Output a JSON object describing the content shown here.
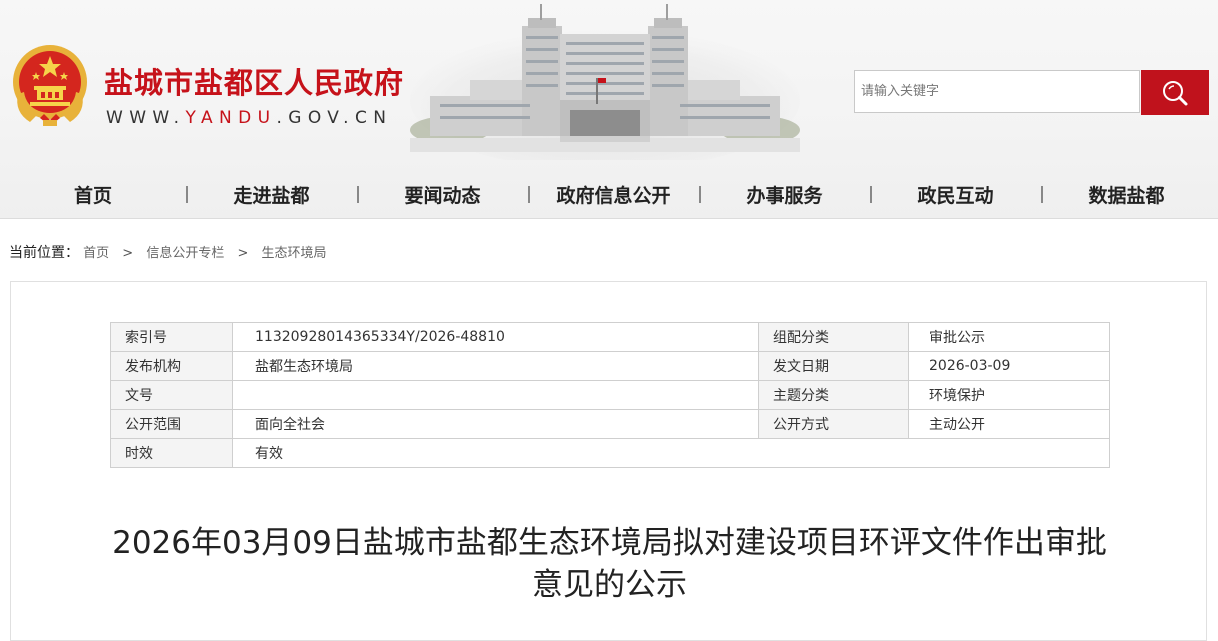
{
  "header": {
    "site_title": "盐城市盐都区人民政府",
    "domain": {
      "prefix": "WWW.",
      "accent": "YANDU",
      "suffix": ".GOV.CN"
    },
    "emblem_icon": "national-emblem-icon",
    "accent_color": "#c6121a"
  },
  "search": {
    "placeholder": "请输入关键字",
    "button_icon": "search-icon"
  },
  "nav": {
    "items": [
      "首页",
      "走进盐都",
      "要闻动态",
      "政府信息公开",
      "办事服务",
      "政民互动",
      "数据盐都"
    ]
  },
  "breadcrumb": {
    "label": "当前位置：",
    "items": [
      "首页",
      "信息公开专栏",
      "生态环境局"
    ],
    "separator": ">"
  },
  "meta": {
    "rows": [
      {
        "k1": "索引号",
        "v1": "11320928014365334Y/2026-48810",
        "k2": "组配分类",
        "v2": "审批公示"
      },
      {
        "k1": "发布机构",
        "v1": "盐都生态环境局",
        "k2": "发文日期",
        "v2": "2026-03-09"
      },
      {
        "k1": "文号",
        "v1": "",
        "k2": "主题分类",
        "v2": "环境保护"
      },
      {
        "k1": "公开范围",
        "v1": "面向全社会",
        "k2": "公开方式",
        "v2": "主动公开"
      },
      {
        "k1": "时效",
        "v1": "有效"
      }
    ]
  },
  "article": {
    "title": "2026年03月09日盐城市盐都生态环境局拟对建设项目环评文件作出审批意见的公示"
  }
}
